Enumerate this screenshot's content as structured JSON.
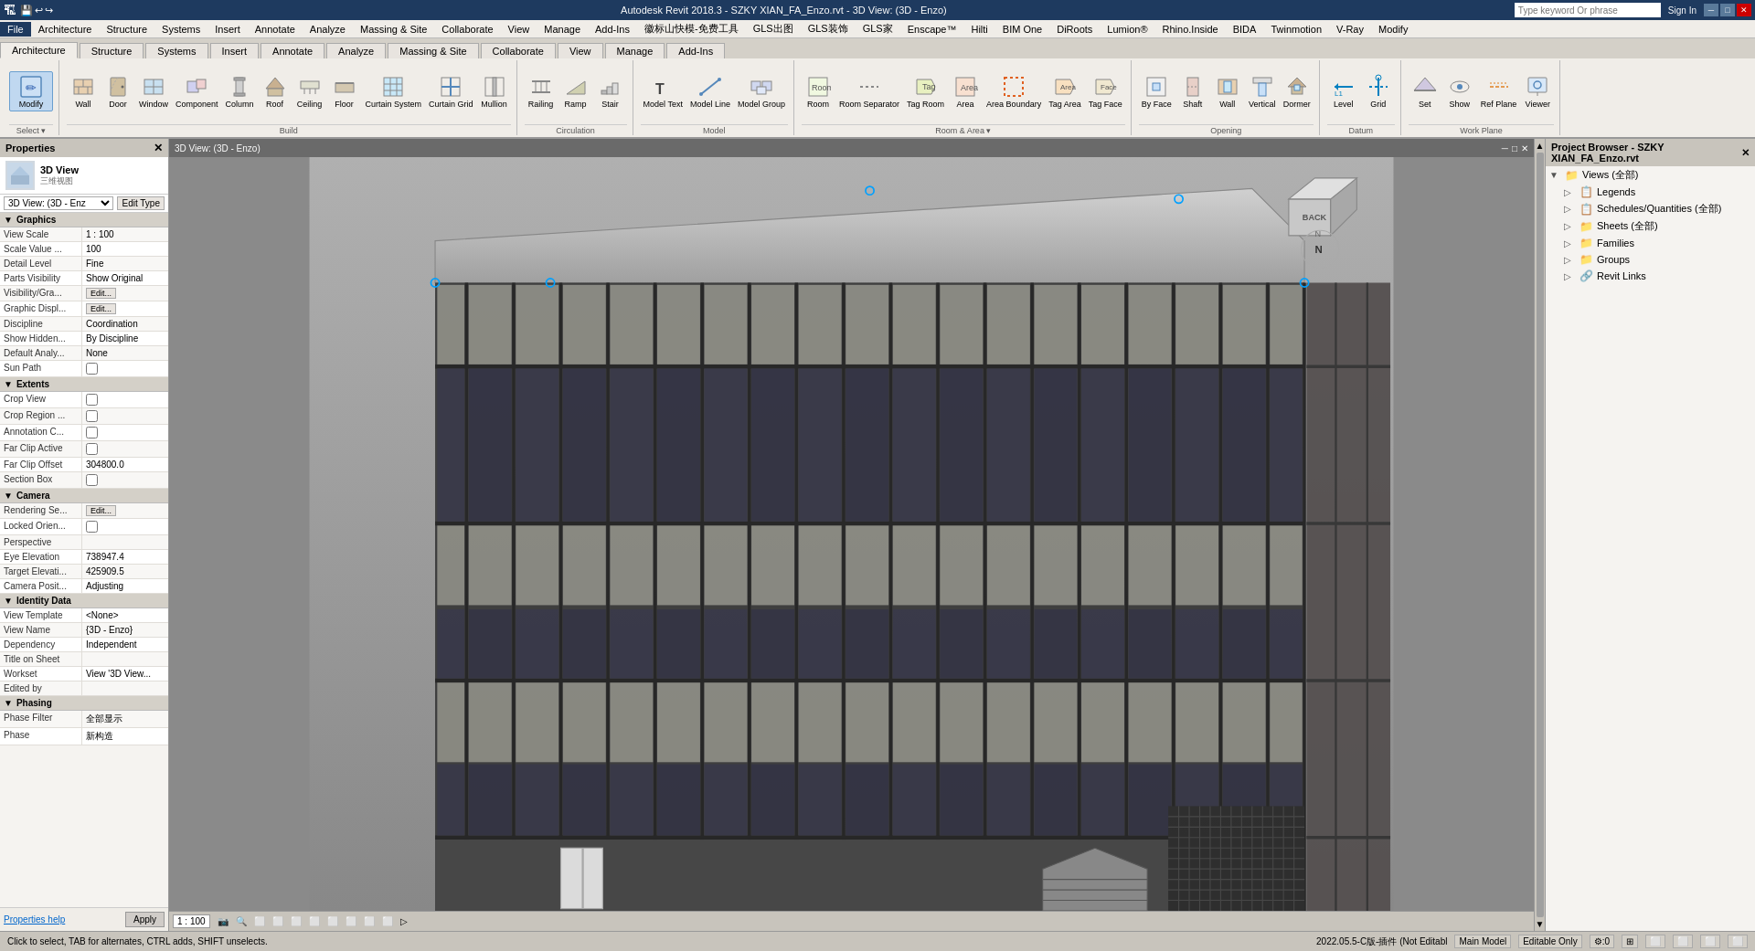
{
  "titlebar": {
    "app_title": "Autodesk Revit 2018.3 - SZKY XIAN_FA_Enzo.rvt - 3D View: (3D - Enzo)",
    "search_placeholder": "Type keyword Or phrase",
    "sign_in": "Sign In",
    "window_btns": [
      "─",
      "□",
      "✕"
    ]
  },
  "menubar": {
    "items": [
      "File",
      "Architecture",
      "Structure",
      "Systems",
      "Insert",
      "Annotate",
      "Analyze",
      "Massing & Site",
      "Collaborate",
      "View",
      "Manage",
      "Add-Ins",
      "徽标山快模-免费工具",
      "GLS出图",
      "GLS装饰",
      "GLS家",
      "Enscape™",
      "Hilti",
      "BIM One",
      "DiRoots",
      "Lumion®",
      "Rhino.Inside",
      "BIDA",
      "Twinmotion",
      "V-Ray",
      "Modify"
    ]
  },
  "ribbon": {
    "active_tab": "Architecture",
    "tabs": [
      "Architecture",
      "Structure",
      "Systems",
      "Insert",
      "Annotate",
      "Analyze",
      "Massing & Site",
      "Collaborate",
      "View",
      "Manage",
      "Add-Ins"
    ],
    "groups": {
      "select": {
        "label": "Select",
        "buttons": [
          {
            "icon": "✏",
            "text": "Modify",
            "active": true
          }
        ]
      },
      "build": {
        "label": "Build",
        "buttons": [
          {
            "icon": "🏠",
            "text": "Wall"
          },
          {
            "icon": "🚪",
            "text": "Door"
          },
          {
            "icon": "🪟",
            "text": "Window"
          },
          {
            "icon": "⬜",
            "text": "Component"
          },
          {
            "icon": "⬛",
            "text": "Column"
          },
          {
            "icon": "🏗",
            "text": "Roof"
          },
          {
            "icon": "⬜",
            "text": "Ceiling"
          },
          {
            "icon": "▭",
            "text": "Floor"
          },
          {
            "icon": "▦",
            "text": "Curtain System"
          },
          {
            "icon": "▦",
            "text": "Curtain Grid"
          },
          {
            "icon": "▬",
            "text": "Mullion"
          }
        ]
      },
      "circulation": {
        "label": "Circulation",
        "buttons": [
          {
            "icon": "⟳",
            "text": "Railing"
          },
          {
            "icon": "↗",
            "text": "Ramp"
          },
          {
            "icon": "🪜",
            "text": "Stair"
          }
        ]
      },
      "model": {
        "label": "Model",
        "buttons": [
          {
            "icon": "T",
            "text": "Model Text"
          },
          {
            "icon": "—",
            "text": "Model Line"
          },
          {
            "icon": "⬡",
            "text": "Model Group"
          }
        ]
      },
      "room_area": {
        "label": "Room & Area",
        "buttons": [
          {
            "icon": "⬜",
            "text": "Room"
          },
          {
            "icon": "⬜",
            "text": "Room Separator"
          },
          {
            "icon": "🏷",
            "text": "Tag Room"
          },
          {
            "icon": "A",
            "text": "Area"
          },
          {
            "icon": "⬜",
            "text": "Area Boundary"
          },
          {
            "icon": "🏷",
            "text": "Tag Area"
          },
          {
            "icon": "⬜",
            "text": "Tag Face"
          }
        ]
      },
      "opening": {
        "label": "Opening",
        "buttons": [
          {
            "icon": "⊞",
            "text": "By Face"
          },
          {
            "icon": "⬜",
            "text": "Shaft"
          },
          {
            "icon": "▭",
            "text": "Wall"
          },
          {
            "icon": "↕",
            "text": "Vertical"
          },
          {
            "icon": "⬡",
            "text": "Dormer"
          }
        ]
      },
      "datum": {
        "label": "Datum",
        "buttons": [
          {
            "icon": "↕",
            "text": "Level"
          },
          {
            "icon": "⊞",
            "text": "Grid"
          }
        ]
      },
      "work_plane": {
        "label": "Work Plane",
        "buttons": [
          {
            "icon": "⬜",
            "text": "Set"
          },
          {
            "icon": "👁",
            "text": "Show"
          },
          {
            "icon": "⬜",
            "text": "Ref Plane"
          },
          {
            "icon": "👁",
            "text": "Viewer"
          }
        ]
      }
    }
  },
  "properties": {
    "title": "Properties",
    "object_type": "3D View",
    "object_subtype": "三维视图",
    "type_selector_value": "3D View: (3D - Enz",
    "edit_type_label": "Edit Type",
    "sections": {
      "graphics": {
        "label": "Graphics",
        "rows": [
          {
            "label": "View Scale",
            "value": "1 : 100"
          },
          {
            "label": "Scale Value ...",
            "value": "100"
          },
          {
            "label": "Detail Level",
            "value": "Fine"
          },
          {
            "label": "Parts Visibility",
            "value": "Show Original"
          },
          {
            "label": "Visibility/Gra...",
            "value": "Edit...",
            "type": "button"
          },
          {
            "label": "Graphic Displ...",
            "value": "Edit...",
            "type": "button"
          },
          {
            "label": "Discipline",
            "value": "Coordination"
          },
          {
            "label": "Show Hidden...",
            "value": "By Discipline"
          },
          {
            "label": "Default Analy...",
            "value": "None"
          },
          {
            "label": "Sun Path",
            "value": "",
            "type": "checkbox"
          }
        ]
      },
      "extents": {
        "label": "Extents",
        "rows": [
          {
            "label": "Crop View",
            "value": "",
            "type": "checkbox"
          },
          {
            "label": "Crop Region ...",
            "value": "",
            "type": "checkbox"
          },
          {
            "label": "Annotation C...",
            "value": "",
            "type": "checkbox"
          },
          {
            "label": "Far Clip Active",
            "value": "",
            "type": "checkbox"
          },
          {
            "label": "Far Clip Offset",
            "value": "304800.0"
          },
          {
            "label": "Section Box",
            "value": "",
            "type": "checkbox"
          }
        ]
      },
      "camera": {
        "label": "Camera",
        "rows": [
          {
            "label": "Rendering Se...",
            "value": "Edit...",
            "type": "button"
          },
          {
            "label": "Locked Orien...",
            "value": "",
            "type": "checkbox"
          },
          {
            "label": "Perspective",
            "value": ""
          },
          {
            "label": "Eye Elevation",
            "value": "738947.4"
          },
          {
            "label": "Target Elevati...",
            "value": "425909.5"
          },
          {
            "label": "Camera Posit...",
            "value": "Adjusting"
          }
        ]
      },
      "identity": {
        "label": "Identity Data",
        "rows": [
          {
            "label": "View Template",
            "value": "<None>"
          },
          {
            "label": "View Name",
            "value": "{3D - Enzo}"
          },
          {
            "label": "Dependency",
            "value": "Independent"
          },
          {
            "label": "Title on Sheet",
            "value": ""
          },
          {
            "label": "Workset",
            "value": "View '3D View..."
          },
          {
            "label": "Edited by",
            "value": ""
          }
        ]
      },
      "phasing": {
        "label": "Phasing",
        "rows": [
          {
            "label": "Phase Filter",
            "value": "全部显示"
          },
          {
            "label": "Phase",
            "value": "新构造"
          }
        ]
      }
    },
    "footer": {
      "help_link": "Properties help",
      "apply_btn": "Apply"
    }
  },
  "viewport": {
    "title": "3D View: (3D - Enzo)",
    "scale": "1 : 100",
    "statusbar_icons": [
      "📷",
      "🔍",
      "⬜",
      "⬜",
      "⬜",
      "⬜",
      "⬜",
      "⬜",
      "⬜",
      "⬜"
    ],
    "toolbar_icons": [
      "⬜",
      "⬜",
      "⬜",
      "⬜",
      "⬜",
      "⬜",
      "⬜",
      "⬜",
      "⬜",
      "⬜"
    ]
  },
  "project_browser": {
    "title": "Project Browser - SZKY XIAN_FA_Enzo.rvt",
    "items": [
      {
        "label": "Views (全部)",
        "indent": 0,
        "has_children": true,
        "icon": "📁"
      },
      {
        "label": "Legends",
        "indent": 1,
        "has_children": false,
        "icon": "📋"
      },
      {
        "label": "Schedules/Quantities (全部)",
        "indent": 1,
        "has_children": false,
        "icon": "📋"
      },
      {
        "label": "Sheets (全部)",
        "indent": 1,
        "has_children": true,
        "icon": "📁"
      },
      {
        "label": "Families",
        "indent": 1,
        "has_children": true,
        "icon": "📁"
      },
      {
        "label": "Groups",
        "indent": 1,
        "has_children": true,
        "icon": "📁"
      },
      {
        "label": "Revit Links",
        "indent": 1,
        "has_children": false,
        "icon": "🔗"
      }
    ]
  },
  "status_bar": {
    "left_text": "Click to select, TAB for alternates, CTRL adds, SHIFT unselects.",
    "date_version": "2022.05.5-C版-插件 (Not Editabl",
    "model_mode": "Main Model",
    "editable": "Editable Only",
    "right_items": [
      "⚙:0",
      "⊞",
      "⬜",
      "⬜",
      "⬜",
      "⬜"
    ]
  }
}
